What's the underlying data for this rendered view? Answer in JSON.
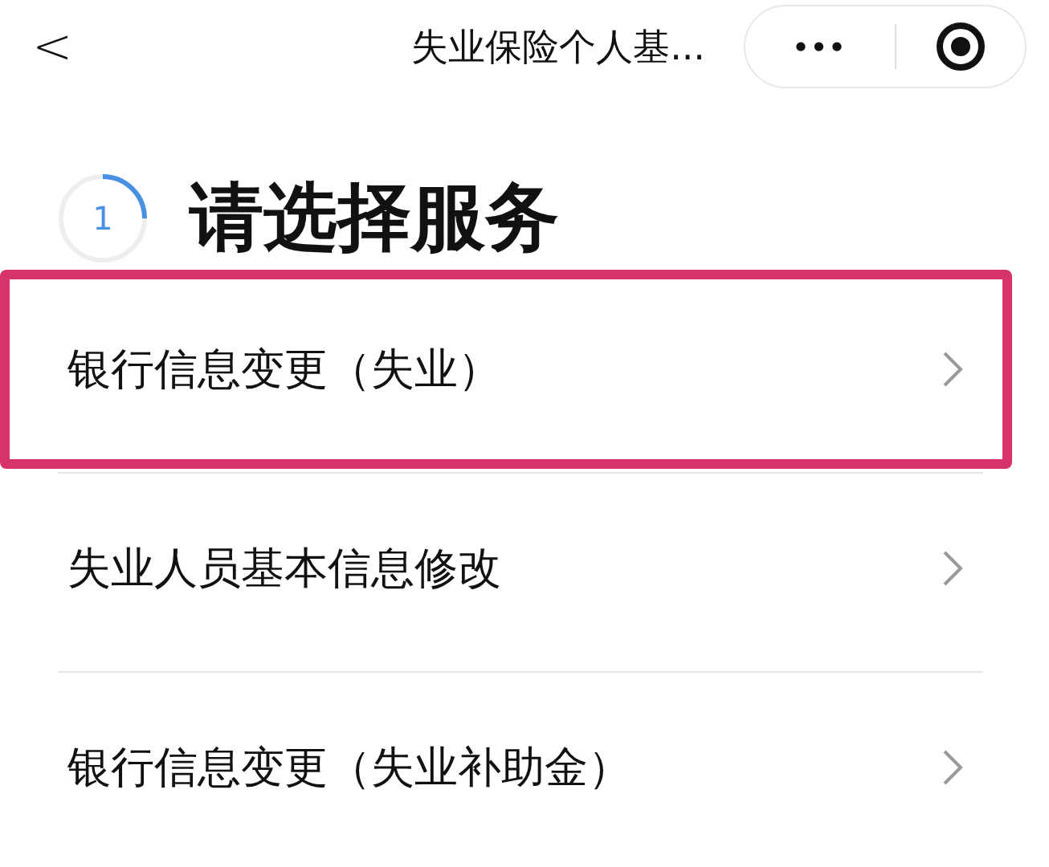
{
  "nav_bar": {
    "back": "<",
    "title": "失业保险个人基...",
    "more": "•••"
  },
  "step": {
    "number": "1",
    "level": 0.25,
    "heading": "请选择服务"
  },
  "services": [
    {
      "label": "银行信息变更（失业）",
      "highlighted": true
    },
    {
      "label": "失业人员基本信息修改",
      "highlighted": false
    },
    {
      "label": "银行信息变更（失业补助金）",
      "highlighted": false
    }
  ]
}
